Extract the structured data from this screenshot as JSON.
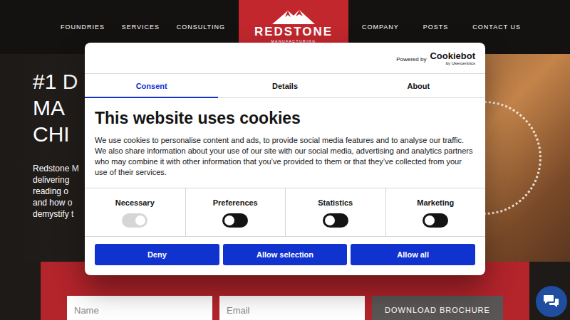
{
  "nav": {
    "left": [
      "FOUNDRIES",
      "SERVICES",
      "CONSULTING"
    ],
    "right": [
      "COMPANY",
      "POSTS",
      "CONTACT US"
    ]
  },
  "logo": {
    "name": "REDSTONE",
    "tagline": "MANUFACTURING"
  },
  "hero": {
    "title_lines": [
      "#1 D",
      "MA",
      "CHI"
    ],
    "text_lines": [
      "Redstone M",
      "delivering",
      "reading o",
      "and how o",
      "demystify t"
    ]
  },
  "form": {
    "fields": [
      {
        "placeholder": "Name"
      },
      {
        "placeholder": "Email"
      }
    ],
    "button": "DOWNLOAD BROCHURE"
  },
  "cookie_dialog": {
    "powered_by": "Powered by",
    "brand": "Cookiebot",
    "brand_sub": "by Usercentrics",
    "tabs": [
      {
        "label": "Consent",
        "selected": true
      },
      {
        "label": "Details",
        "selected": false
      },
      {
        "label": "About",
        "selected": false
      }
    ],
    "title": "This website uses cookies",
    "body": "We use cookies to personalise content and ads, to provide social media features and to analyse our traffic. We also share information about your use of our site with our social media, advertising and analytics partners who may combine it with other information that you’ve provided to them or that they’ve collected from your use of their services.",
    "categories": [
      {
        "label": "Necessary",
        "on": true,
        "disabled": true
      },
      {
        "label": "Preferences",
        "on": false,
        "disabled": false
      },
      {
        "label": "Statistics",
        "on": false,
        "disabled": false
      },
      {
        "label": "Marketing",
        "on": false,
        "disabled": false
      }
    ],
    "buttons": [
      "Deny",
      "Allow selection",
      "Allow all"
    ]
  }
}
